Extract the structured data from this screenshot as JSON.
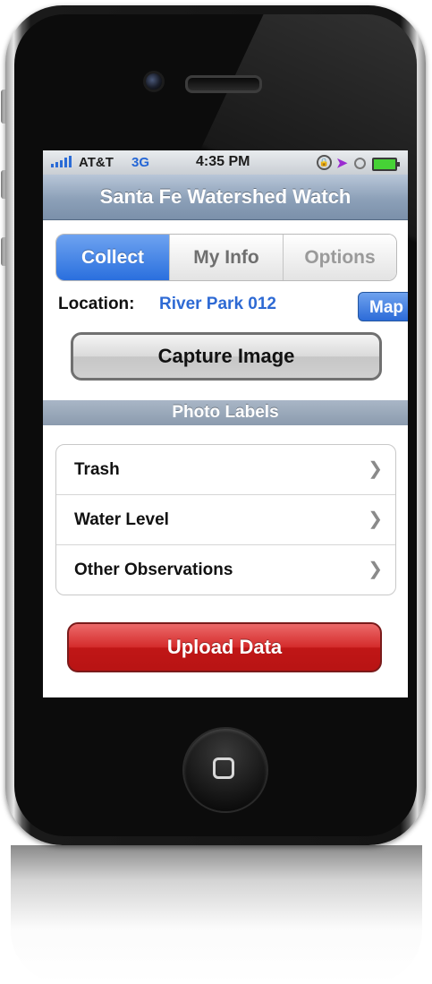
{
  "status_bar": {
    "carrier": "AT&T",
    "network": "3G",
    "time": "4:35 PM",
    "icons": [
      "signal-bars-icon",
      "rotation-lock-icon",
      "location-arrow-icon",
      "alarm-icon",
      "battery-icon"
    ]
  },
  "navbar": {
    "title": "Santa Fe Watershed Watch"
  },
  "tabs": [
    {
      "label": "Collect",
      "selected": true
    },
    {
      "label": "My Info",
      "selected": false
    },
    {
      "label": "Options",
      "selected": false
    }
  ],
  "location": {
    "label": "Location:",
    "value": "River Park 012",
    "map_button": "Map"
  },
  "capture_button": "Capture Image",
  "section_header": "Photo Labels",
  "photo_labels": [
    {
      "label": "Trash"
    },
    {
      "label": "Water Level"
    },
    {
      "label": "Other Observations"
    }
  ],
  "upload_button": "Upload Data",
  "colors": {
    "accent_blue": "#2a6fde",
    "upload_red": "#c01616",
    "nav_bar": "#8ca0b8"
  }
}
